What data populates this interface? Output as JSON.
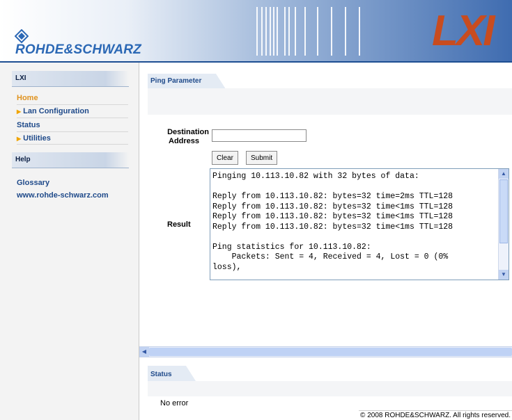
{
  "header": {
    "logo_text": "ROHDE&SCHWARZ",
    "lxi_text": "LXI",
    "accent": "#2b68b5",
    "lxi_color": "#c84c1f"
  },
  "sidebar": {
    "section1_title": "LXI",
    "items": [
      {
        "label": "Home",
        "arrow": false
      },
      {
        "label": "Lan Configuration",
        "arrow": true
      },
      {
        "label": "Status",
        "arrow": false
      },
      {
        "label": "Utilities",
        "arrow": true
      }
    ],
    "section2_title": "Help",
    "help_items": [
      {
        "label": "Glossary"
      },
      {
        "label": "www.rohde-schwarz.com"
      }
    ]
  },
  "main": {
    "tab_label": "Ping Parameter",
    "destination_label_line1": "Destination",
    "destination_label_line2": "Address",
    "destination_value": "",
    "clear_label": "Clear",
    "submit_label": "Submit",
    "result_label": "Result",
    "result_text": "Pinging 10.113.10.82 with 32 bytes of data:\n\nReply from 10.113.10.82: bytes=32 time=2ms TTL=128\nReply from 10.113.10.82: bytes=32 time<1ms TTL=128\nReply from 10.113.10.82: bytes=32 time<1ms TTL=128\nReply from 10.113.10.82: bytes=32 time<1ms TTL=128\n\nPing statistics for 10.113.10.82:\n    Packets: Sent = 4, Received = 4, Lost = 0 (0%\nloss),",
    "status_tab_label": "Status",
    "status_text": "No error"
  },
  "footer": {
    "copyright": "© 2008 ROHDE&SCHWARZ. All rights reserved."
  }
}
